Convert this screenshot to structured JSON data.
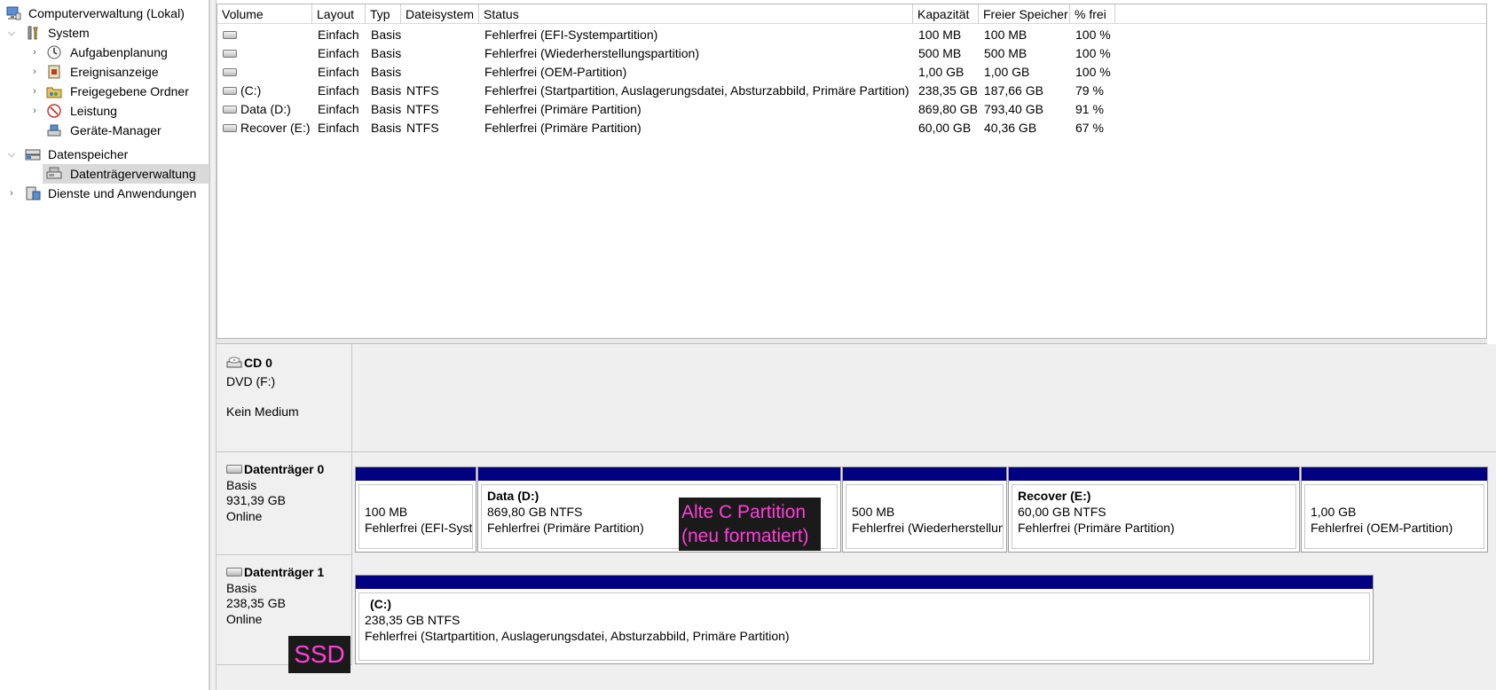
{
  "tree": {
    "root": "Computerverwaltung (Lokal)",
    "system": "System",
    "items": [
      "Aufgabenplanung",
      "Ereignisanzeige",
      "Freigegebene Ordner",
      "Leistung",
      "Geräte-Manager"
    ],
    "storage": "Datenspeicher",
    "disk_mgmt": "Datenträgerverwaltung",
    "services": "Dienste und Anwendungen"
  },
  "volumes": {
    "headers": [
      "Volume",
      "Layout",
      "Typ",
      "Dateisystem",
      "Status",
      "Kapazität",
      "Freier Speicher",
      "% frei"
    ],
    "rows": [
      {
        "volume": "",
        "layout": "Einfach",
        "typ": "Basis",
        "fs": "",
        "status": "Fehlerfrei (EFI-Systempartition)",
        "cap": "100 MB",
        "free": "100 MB",
        "pct": "100 %"
      },
      {
        "volume": "",
        "layout": "Einfach",
        "typ": "Basis",
        "fs": "",
        "status": "Fehlerfrei (Wiederherstellungspartition)",
        "cap": "500 MB",
        "free": "500 MB",
        "pct": "100 %"
      },
      {
        "volume": "",
        "layout": "Einfach",
        "typ": "Basis",
        "fs": "",
        "status": "Fehlerfrei (OEM-Partition)",
        "cap": "1,00 GB",
        "free": "1,00 GB",
        "pct": "100 %"
      },
      {
        "volume": "(C:)",
        "layout": "Einfach",
        "typ": "Basis",
        "fs": "NTFS",
        "status": "Fehlerfrei (Startpartition, Auslagerungsdatei, Absturzabbild, Primäre Partition)",
        "cap": "238,35 GB",
        "free": "187,66 GB",
        "pct": "79 %"
      },
      {
        "volume": "Data (D:)",
        "layout": "Einfach",
        "typ": "Basis",
        "fs": "NTFS",
        "status": "Fehlerfrei (Primäre Partition)",
        "cap": "869,80 GB",
        "free": "793,40 GB",
        "pct": "91 %"
      },
      {
        "volume": "Recover (E:)",
        "layout": "Einfach",
        "typ": "Basis",
        "fs": "NTFS",
        "status": "Fehlerfrei (Primäre Partition)",
        "cap": "60,00 GB",
        "free": "40,36 GB",
        "pct": "67 %"
      }
    ]
  },
  "disks": {
    "cd0": {
      "name": "CD 0",
      "type": "DVD (F:)",
      "medium": "Kein Medium"
    },
    "disk0": {
      "name": "Datenträger 0",
      "type": "Basis",
      "size": "931,39 GB",
      "state": "Online",
      "parts": [
        {
          "title": "",
          "size": "100 MB",
          "status": "Fehlerfrei (EFI-Systempartition)"
        },
        {
          "title": "Data  (D:)",
          "size": "869,80 GB NTFS",
          "status": "Fehlerfrei (Primäre Partition)"
        },
        {
          "title": "",
          "size": "500 MB",
          "status": "Fehlerfrei (Wiederherstellungspartition)"
        },
        {
          "title": "Recover  (E:)",
          "size": "60,00 GB NTFS",
          "status": "Fehlerfrei (Primäre Partition)"
        },
        {
          "title": "",
          "size": "1,00 GB",
          "status": "Fehlerfrei (OEM-Partition)"
        }
      ]
    },
    "disk1": {
      "name": "Datenträger 1",
      "type": "Basis",
      "size": "238,35 GB",
      "state": "Online",
      "parts": [
        {
          "title": "(C:)",
          "size": "238,35 GB NTFS",
          "status": "Fehlerfrei (Startpartition, Auslagerungsdatei, Absturzabbild, Primäre Partition)"
        }
      ]
    }
  },
  "annotations": {
    "alt_c_line1": "Alte C Partition",
    "alt_c_line2": "(neu formatiert)",
    "ssd": "SSD",
    "color": "#ff3fd8"
  },
  "colors": {
    "partition_bar": "#000080",
    "selection": "#d9d9d9"
  }
}
